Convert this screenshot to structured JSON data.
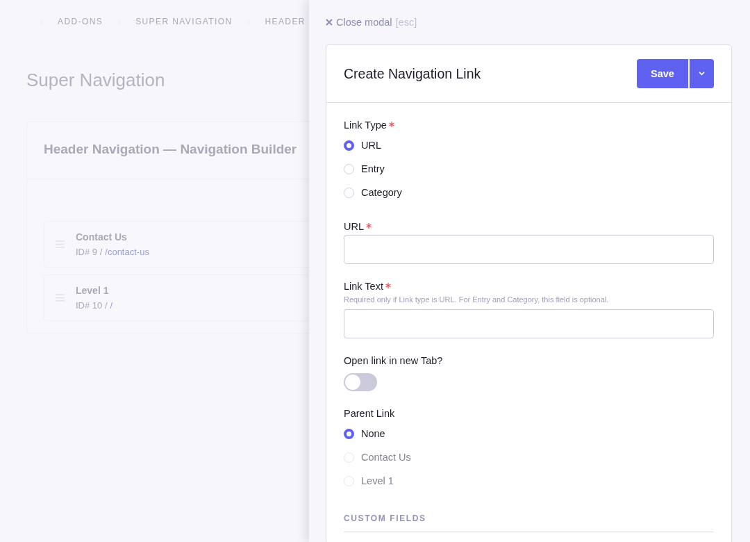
{
  "background": {
    "breadcrumbs": [
      "ADD-ONS",
      "SUPER NAVIGATION",
      "HEADER"
    ],
    "page_title": "Super Navigation",
    "builder": {
      "title": "Header Navigation — Navigation Builder",
      "items": [
        {
          "title": "Contact Us",
          "id": "ID# 9 /",
          "path": "/contact-us"
        },
        {
          "title": "Level 1",
          "id": "ID# 10 /",
          "path": "/"
        }
      ]
    }
  },
  "modal": {
    "close": {
      "label": "Close modal",
      "key": "[esc]"
    },
    "title": "Create Navigation Link",
    "save": "Save",
    "fields": [
      {
        "kind": "radio",
        "label": "Link Type",
        "required": true,
        "options": [
          {
            "label": "URL",
            "selected": true,
            "disabled": false
          },
          {
            "label": "Entry",
            "selected": false,
            "disabled": false
          },
          {
            "label": "Category",
            "selected": false,
            "disabled": false
          }
        ]
      },
      {
        "kind": "text",
        "label": "URL",
        "required": true
      },
      {
        "kind": "text",
        "label": "Link Text",
        "required": true,
        "hint": "Required only if Link type is URL. For Entry and Category, this field is optional."
      },
      {
        "kind": "toggle",
        "label": "Open link in new Tab?",
        "required": false,
        "on": false
      },
      {
        "kind": "radio",
        "label": "Parent Link",
        "required": false,
        "options": [
          {
            "label": "None",
            "selected": true,
            "disabled": false
          },
          {
            "label": "Contact Us",
            "selected": false,
            "disabled": true
          },
          {
            "label": "Level 1",
            "selected": false,
            "disabled": true
          }
        ]
      }
    ],
    "section": "CUSTOM FIELDS"
  }
}
